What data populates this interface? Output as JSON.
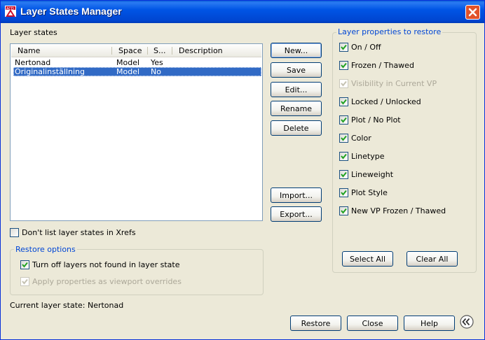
{
  "window": {
    "title": "Layer States Manager"
  },
  "layer_states": {
    "label": "Layer states",
    "columns": [
      "Name",
      "Space",
      "S...",
      "Description"
    ],
    "rows": [
      {
        "name": "Nertonad",
        "space": "Model",
        "saved": "Yes",
        "description": "",
        "selected": false
      },
      {
        "name": "Originalinställning",
        "space": "Model",
        "saved": "No",
        "description": "",
        "selected": true
      }
    ]
  },
  "buttons": {
    "new": "New...",
    "save": "Save",
    "edit": "Edit...",
    "rename": "Rename",
    "delete": "Delete",
    "import": "Import...",
    "export": "Export...",
    "restore": "Restore",
    "close": "Close",
    "help": "Help",
    "select_all": "Select All",
    "clear_all": "Clear All"
  },
  "dont_list_xrefs": {
    "label": "Don't list layer states in Xrefs",
    "checked": false
  },
  "restore_options": {
    "title": "Restore options",
    "turn_off": {
      "label": "Turn off layers not found in layer state",
      "checked": true
    },
    "apply_viewport": {
      "label": "Apply properties as viewport overrides",
      "checked": true,
      "disabled": true
    }
  },
  "current_state": {
    "text": "Current layer state: Nertonad"
  },
  "properties": {
    "title": "Layer properties to restore",
    "items": [
      {
        "label": "On / Off",
        "checked": true,
        "disabled": false
      },
      {
        "label": "Frozen / Thawed",
        "checked": true,
        "disabled": false
      },
      {
        "label": "Visibility in Current VP",
        "checked": true,
        "disabled": true
      },
      {
        "label": "Locked / Unlocked",
        "checked": true,
        "disabled": false
      },
      {
        "label": "Plot / No Plot",
        "checked": true,
        "disabled": false
      },
      {
        "label": "Color",
        "checked": true,
        "disabled": false
      },
      {
        "label": "Linetype",
        "checked": true,
        "disabled": false
      },
      {
        "label": "Lineweight",
        "checked": true,
        "disabled": false
      },
      {
        "label": "Plot Style",
        "checked": true,
        "disabled": false
      },
      {
        "label": "New VP Frozen / Thawed",
        "checked": true,
        "disabled": false
      }
    ]
  },
  "icons": {
    "app": "autocad-app-icon",
    "close": "close-icon",
    "collapse": "chevron-left-icon",
    "check": "check-icon"
  },
  "colors": {
    "title_bar": "#0055e5",
    "selection": "#316ac5",
    "group_title": "#0046d5",
    "close_button": "#e2522a",
    "check": "#21a121"
  }
}
